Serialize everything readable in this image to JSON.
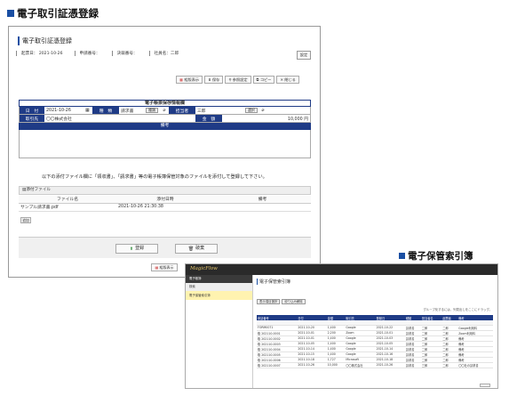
{
  "heading1": "電子取引証憑登録",
  "heading2": "電子保管索引簿",
  "form": {
    "title": "電子取引証憑登録",
    "print_btn": "設定",
    "meta": [
      "起票日： 2021-10-26",
      "申請番号：",
      "決裁番号：",
      "社員名：二郎"
    ],
    "toolbar": [
      "組版表示",
      "保存",
      "参照設定",
      "コピー",
      "閉じる"
    ],
    "section_title": "電子帳票保存情報欄",
    "fields": {
      "date_label": "日　付",
      "date_value": "2021-10-26",
      "type_label": "種　類",
      "type_value": "請求書",
      "type_btn": "種類",
      "person_label": "担当者",
      "person_value": "三郎",
      "person_btn": "選択",
      "partner_label": "取引先",
      "partner_value": "〇〇株式会社",
      "amount_label": "金　額",
      "amount_value": "10,000 円",
      "memo_label": "備考"
    },
    "note": "以下の添付ファイル欄に「領収書」、「請求書」等の電子帳簿保管対象のファイルを添付して登録して下さい。",
    "attach_header": "添付ファイル",
    "attach_columns": [
      "ファイル名",
      "添付日時",
      "備考"
    ],
    "attach_rows": [
      [
        "サンプル請求書.pdf",
        "2021-10-26 21:30:38",
        ""
      ]
    ],
    "add_btn": "追加",
    "register_btn": "登録",
    "discard_btn": "破棄",
    "preview_btn": "組版表示"
  },
  "index": {
    "logo": "MagicFlow",
    "side_header": "電子帳簿",
    "side_sub": "検索",
    "side_active": "電子保管索引簿",
    "title": "電子保管索引簿",
    "buttons": [
      "表示項目選択",
      "絞り込み解除"
    ],
    "info": "グループ化するには、列見出しをここにドラッグ。",
    "columns": [
      "申請番号",
      "日付",
      "金額",
      "取引先",
      "登録日",
      "種類",
      "担当者名",
      "起票者",
      "備考"
    ],
    "rows": [
      [
        "FORM0071",
        "2021-10-20",
        "1,400",
        "Google",
        "2021-10-22",
        "請求書",
        "二郎",
        "二郎",
        "Google利用料"
      ],
      [
        "取 202110-0001",
        "2021-10-01",
        "2,200",
        "Zoom",
        "2021-10-01",
        "請求書",
        "二郎",
        "二郎",
        "Zoom利用料"
      ],
      [
        "取 202110-0002",
        "2021-10-01",
        "1,400",
        "Google",
        "2021-10-03",
        "請求書",
        "二郎",
        "二郎",
        "備考"
      ],
      [
        "取 202110-0003",
        "2021-10-05",
        "1,400",
        "Google",
        "2021-10-05",
        "請求書",
        "二郎",
        "二郎",
        "備考"
      ],
      [
        "取 202110-0004",
        "2021-10-14",
        "1,400",
        "Google",
        "2021-10-14",
        "請求書",
        "二郎",
        "二郎",
        "備考"
      ],
      [
        "取 202110-0005",
        "2021-10-15",
        "1,400",
        "Google",
        "2021-10-16",
        "請求書",
        "二郎",
        "二郎",
        "備考"
      ],
      [
        "取 202110-0006",
        "2021-10-18",
        "1,727",
        "Microsoft",
        "2021-10-18",
        "請求書",
        "二郎",
        "二郎",
        "備考"
      ],
      [
        "取 202110-0007",
        "2021-10-26",
        "10,000",
        "〇〇株式会社",
        "2021-10-26",
        "請求書",
        "三郎",
        "二郎",
        "〇〇社の請求書"
      ]
    ]
  }
}
